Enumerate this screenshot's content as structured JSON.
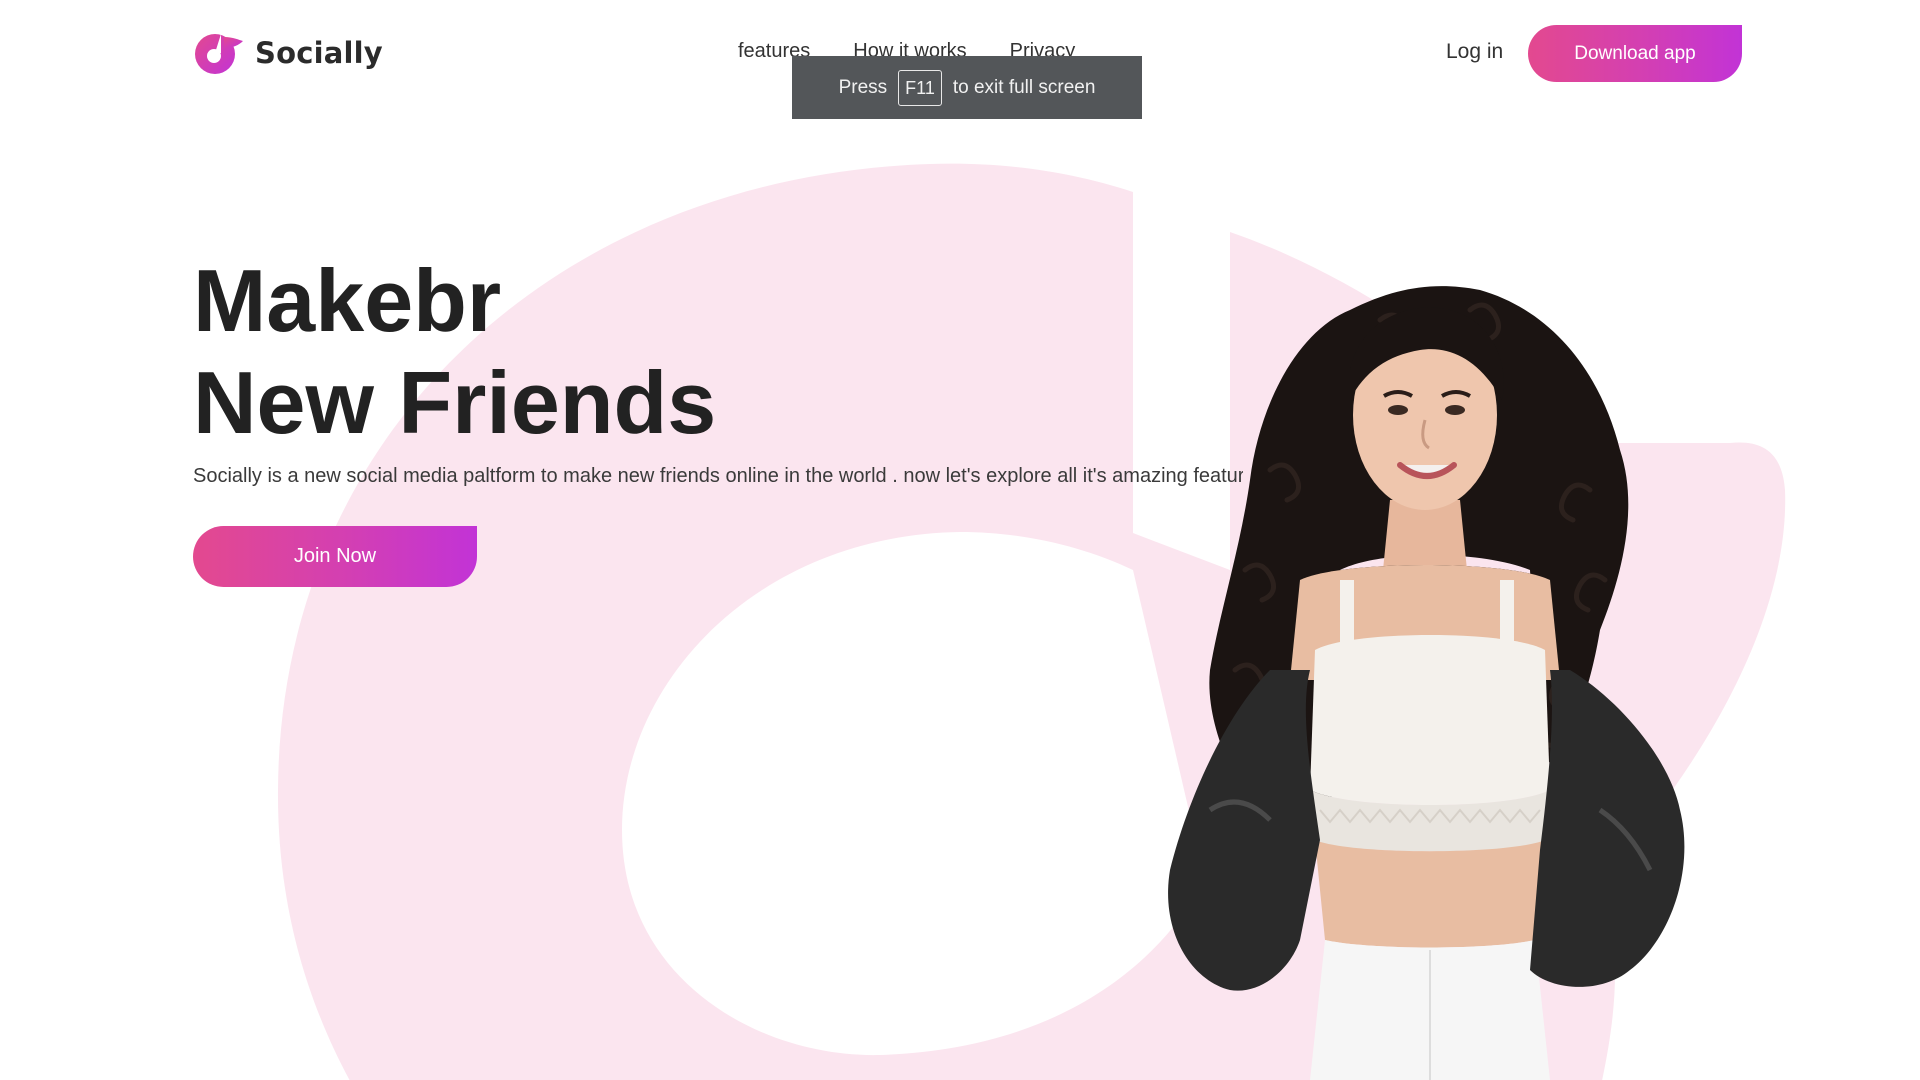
{
  "brand": {
    "name": "Socially",
    "logo_icon": "socially-logo-icon",
    "accent_start": "#e3498f",
    "accent_end": "#c233d6",
    "background_shape_color": "#fbe5ef"
  },
  "nav": {
    "items": [
      {
        "label": "features"
      },
      {
        "label": "How it works"
      },
      {
        "label": "Privacy"
      }
    ],
    "login_label": "Log in",
    "download_label": "Download app"
  },
  "fullscreen_toast": {
    "prefix": "Press",
    "key": "F11",
    "suffix": "to exit full screen"
  },
  "hero": {
    "title_line1": "Makebr",
    "title_line2": "New Friends",
    "description": "Socially is a new social media paltform to make new friends online in the world . now let's explore all it's amazing features",
    "cta_label": "Join Now",
    "image": "woman-curly-hair-photo"
  }
}
